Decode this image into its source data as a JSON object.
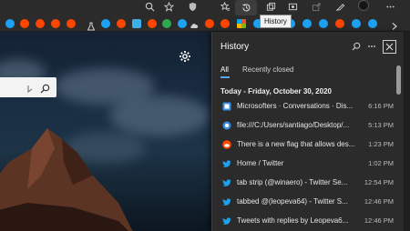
{
  "toolbar": {
    "icons": [
      "search-icon",
      "star-icon",
      "shield-icon",
      "favorites-icon",
      "history-icon",
      "collections-icon",
      "screenshot-icon",
      "share-icon",
      "feedback-icon",
      "profile-avatar",
      "more-icon"
    ],
    "history_tooltip": "History"
  },
  "favorites_bar": {
    "colors": {
      "reddit": "#ff4500",
      "twitter": "#1da1f2",
      "edge": "#3bb0e6",
      "green": "#2fa84f"
    }
  },
  "history_panel": {
    "title": "History",
    "tabs": [
      {
        "label": "All",
        "selected": true
      },
      {
        "label": "Recently closed",
        "selected": false
      }
    ],
    "date_heading": "Today - Friday, October 30, 2020",
    "items": [
      {
        "icon": "microsoft-icon",
        "title": "Microsofters · Conversations · Dis...",
        "time": "6:16 PM"
      },
      {
        "icon": "file-icon",
        "title": "file:///C:/Users/santiago/Desktop/...",
        "time": "5:13 PM"
      },
      {
        "icon": "reddit-icon",
        "title": "There is a new flag that allows des...",
        "time": "1:23 PM"
      },
      {
        "icon": "twitter-icon",
        "title": "Home / Twitter",
        "time": "1:02 PM"
      },
      {
        "icon": "twitter-icon",
        "title": "tab strip (@winaero) - Twitter Se...",
        "time": "12:54 PM"
      },
      {
        "icon": "twitter-icon",
        "title": "tabbed @(leopeva64) - Twitter S...",
        "time": "12:46 PM"
      },
      {
        "icon": "twitter-icon",
        "title": "Tweets with replies by Leopeva6...",
        "time": "12:46 PM"
      }
    ],
    "accent": "#5ba3f0"
  }
}
